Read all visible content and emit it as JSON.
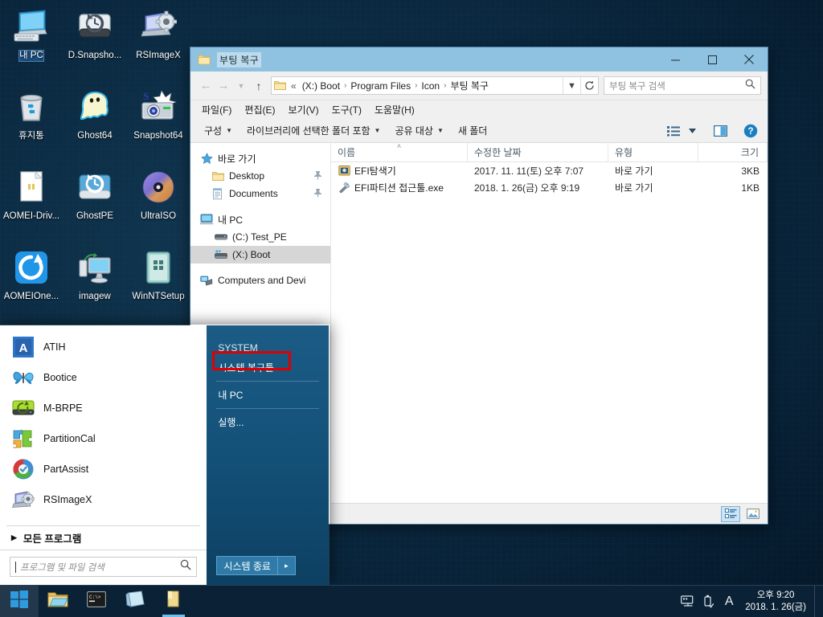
{
  "desktop": {
    "icons": [
      {
        "label": "내 PC",
        "icon": "computer-icon",
        "selected": true
      },
      {
        "label": "D.Snapsho...",
        "icon": "drive-snapshot-icon",
        "selected": false
      },
      {
        "label": "RSImageX",
        "icon": "rsimagex-icon",
        "selected": false
      },
      {
        "label": "휴지통",
        "icon": "recycle-bin-icon",
        "selected": false
      },
      {
        "label": "Ghost64",
        "icon": "ghost-icon",
        "selected": false
      },
      {
        "label": "Snapshot64",
        "icon": "snapshot-camera-icon",
        "selected": false
      },
      {
        "label": "AOMEI-Driv...",
        "icon": "document-icon",
        "selected": false
      },
      {
        "label": "GhostPE",
        "icon": "ghostpe-drive-icon",
        "selected": false
      },
      {
        "label": "UltraISO",
        "icon": "disc-icon",
        "selected": false
      },
      {
        "label": "AOMEIOne...",
        "icon": "aomei-onekey-icon",
        "selected": false
      },
      {
        "label": "imagew",
        "icon": "imagew-monitor-icon",
        "selected": false
      },
      {
        "label": "WinNTSetup",
        "icon": "winntsetup-icon",
        "selected": false
      }
    ]
  },
  "explorer": {
    "title": "부팅 복구",
    "title_icon": "folder-icon",
    "window_buttons": {
      "minimize": "─",
      "maximize": "☐",
      "close": "✕"
    },
    "address": {
      "back_icon": "arrow-left-icon",
      "forward_icon": "arrow-right-icon",
      "recent_icon": "chevron-down-icon",
      "up_icon": "arrow-up-icon",
      "folder_icon": "folder-icon",
      "overflow": "«",
      "crumbs": [
        "(X:) Boot",
        "Program Files",
        "Icon",
        "부팅 복구"
      ],
      "separator": "›",
      "dropdown_icon": "chevron-down-icon",
      "refresh_icon": "refresh-icon"
    },
    "search": {
      "placeholder": "부팅 복구 검색",
      "icon": "search-icon"
    },
    "menubar": [
      {
        "label": "파일(F)"
      },
      {
        "label": "편집(E)"
      },
      {
        "label": "보기(V)"
      },
      {
        "label": "도구(T)"
      },
      {
        "label": "도움말(H)"
      }
    ],
    "commandbar": {
      "items": [
        {
          "label": "구성",
          "has_caret": true
        },
        {
          "label": "라이브러리에 선택한 폴더 포함",
          "has_caret": true
        },
        {
          "label": "공유 대상",
          "has_caret": true
        },
        {
          "label": "새 폴더",
          "has_caret": false
        }
      ],
      "view_icon": "view-options-icon",
      "view_caret_icon": "chevron-down-icon",
      "preview_icon": "preview-pane-icon",
      "help_icon": "help-icon"
    },
    "navpane": {
      "items": [
        {
          "label": "바로 가기",
          "icon": "star-icon",
          "indent": 0,
          "selected": false,
          "pinned": false
        },
        {
          "label": "Desktop",
          "icon": "folder-icon",
          "indent": 1,
          "selected": false,
          "pinned": true
        },
        {
          "label": "Documents",
          "icon": "documents-icon",
          "indent": 1,
          "selected": false,
          "pinned": true
        },
        {
          "label": "내 PC",
          "icon": "computer-icon",
          "indent": 0,
          "selected": false,
          "pinned": false
        },
        {
          "label": "(C:) Test_PE",
          "icon": "drive-icon",
          "indent": 2,
          "selected": false,
          "pinned": false
        },
        {
          "label": "(X:) Boot",
          "icon": "drive-network-icon",
          "indent": 2,
          "selected": true,
          "pinned": false
        },
        {
          "label": "Computers and Devi",
          "icon": "network-icon",
          "indent": 0,
          "selected": false,
          "pinned": false
        }
      ],
      "pin_glyph": "📌"
    },
    "filelist": {
      "columns": [
        "이름",
        "수정한 날짜",
        "유형",
        "크기"
      ],
      "sort_column": "이름",
      "sort_caret": "˄",
      "rows": [
        {
          "name": "EFI탐색기",
          "icon": "efi-explorer-icon",
          "date": "2017. 11. 11(토) 오후 7:07",
          "type": "바로 가기",
          "size": "3KB"
        },
        {
          "name": "EFI파티션 접근툴.exe",
          "icon": "tools-icon",
          "date": "2018. 1. 26(금) 오후 9:19",
          "type": "바로 가기",
          "size": "1KB"
        }
      ]
    },
    "statusbar": {
      "details_view_icon": "details-view-icon",
      "large_icons_view_icon": "large-icons-view-icon",
      "active_view": "details-view-icon"
    }
  },
  "start_menu": {
    "apps": [
      {
        "label": "ATIH",
        "icon": "atih-icon"
      },
      {
        "label": "Bootice",
        "icon": "bootice-butterfly-icon"
      },
      {
        "label": "M-BRPE",
        "icon": "mbrpe-drive-icon"
      },
      {
        "label": "PartitionCal",
        "icon": "partitioncal-puzzle-icon"
      },
      {
        "label": "PartAssist",
        "icon": "partassist-icon"
      },
      {
        "label": "RSImageX",
        "icon": "rsimagex-icon"
      }
    ],
    "all_programs": {
      "label": "모든 프로그램",
      "icon": "triangle-right-icon"
    },
    "search": {
      "placeholder": "프로그램 및 파일 검색",
      "icon": "search-icon"
    },
    "right_items": [
      {
        "label": "SYSTEM",
        "type": "header"
      },
      {
        "label": "시스템 복구툴",
        "type": "link",
        "highlighted": true
      },
      {
        "label": "내 PC",
        "type": "link"
      },
      {
        "label": "실행...",
        "type": "link"
      }
    ],
    "shutdown": {
      "label": "시스템 종료",
      "arrow": "▸"
    },
    "highlight_color": "#e00000"
  },
  "taskbar": {
    "start_icon": "windows-logo-icon",
    "items": [
      {
        "icon": "file-explorer-icon",
        "active": false
      },
      {
        "icon": "command-prompt-icon",
        "active": false
      },
      {
        "icon": "notepad-icon",
        "active": false
      },
      {
        "icon": "folder-icon",
        "active": true
      }
    ],
    "tray": {
      "icons": [
        {
          "icon": "network-icon"
        },
        {
          "icon": "usb-eject-icon"
        },
        {
          "icon": "ime-a-icon",
          "glyph": "A"
        }
      ],
      "time": "오후 9:20",
      "date": "2018. 1. 26(금)"
    }
  }
}
